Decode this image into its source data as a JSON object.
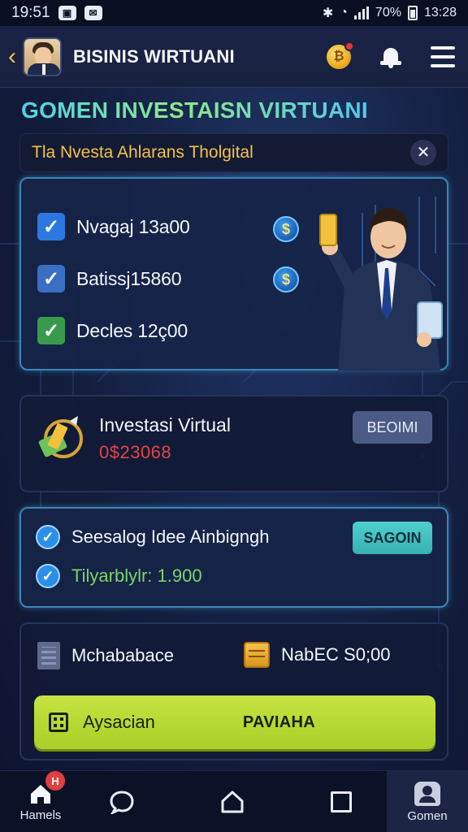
{
  "status_bar": {
    "time": "19:51",
    "battery": "70%",
    "clock_right": "13:28"
  },
  "app_bar": {
    "title": "BISINIS WIRTUANI",
    "coin_symbol": "₿"
  },
  "headline": "GOMEN INVESTAISN VIRTUANI",
  "banner": {
    "text": "Tla Nvesta Ahlarans Tholgital",
    "close_symbol": "✕"
  },
  "checklist": [
    {
      "label": "Nvagaj 13a00",
      "color": "#2c78e0"
    },
    {
      "label": "Batissj15860",
      "color": "#3a6fc4"
    },
    {
      "label": "Decles 12ç00",
      "color": "#3a9a4c"
    }
  ],
  "investment": {
    "title": "Investasi Virtual",
    "value": "0$23068",
    "button": "BEOIMI"
  },
  "tasks": {
    "items": [
      {
        "label": "Seesalog Idee Ainbigngh"
      },
      {
        "label": "Tilyarblylr: 1.900"
      }
    ],
    "button": "SAGOIN"
  },
  "summary": {
    "left_label": "Mchababace",
    "right_label": "NabEC S0;00",
    "action_left": "Aysacian",
    "action_right": "PAVIAHA"
  },
  "bottom_nav": {
    "home_label": "Hamels",
    "home_badge": "H",
    "gomen_label": "Gomen"
  },
  "colors": {
    "accent_lime": "#b9dc35",
    "accent_teal": "#42c2c0",
    "gold": "#f4c14a"
  }
}
